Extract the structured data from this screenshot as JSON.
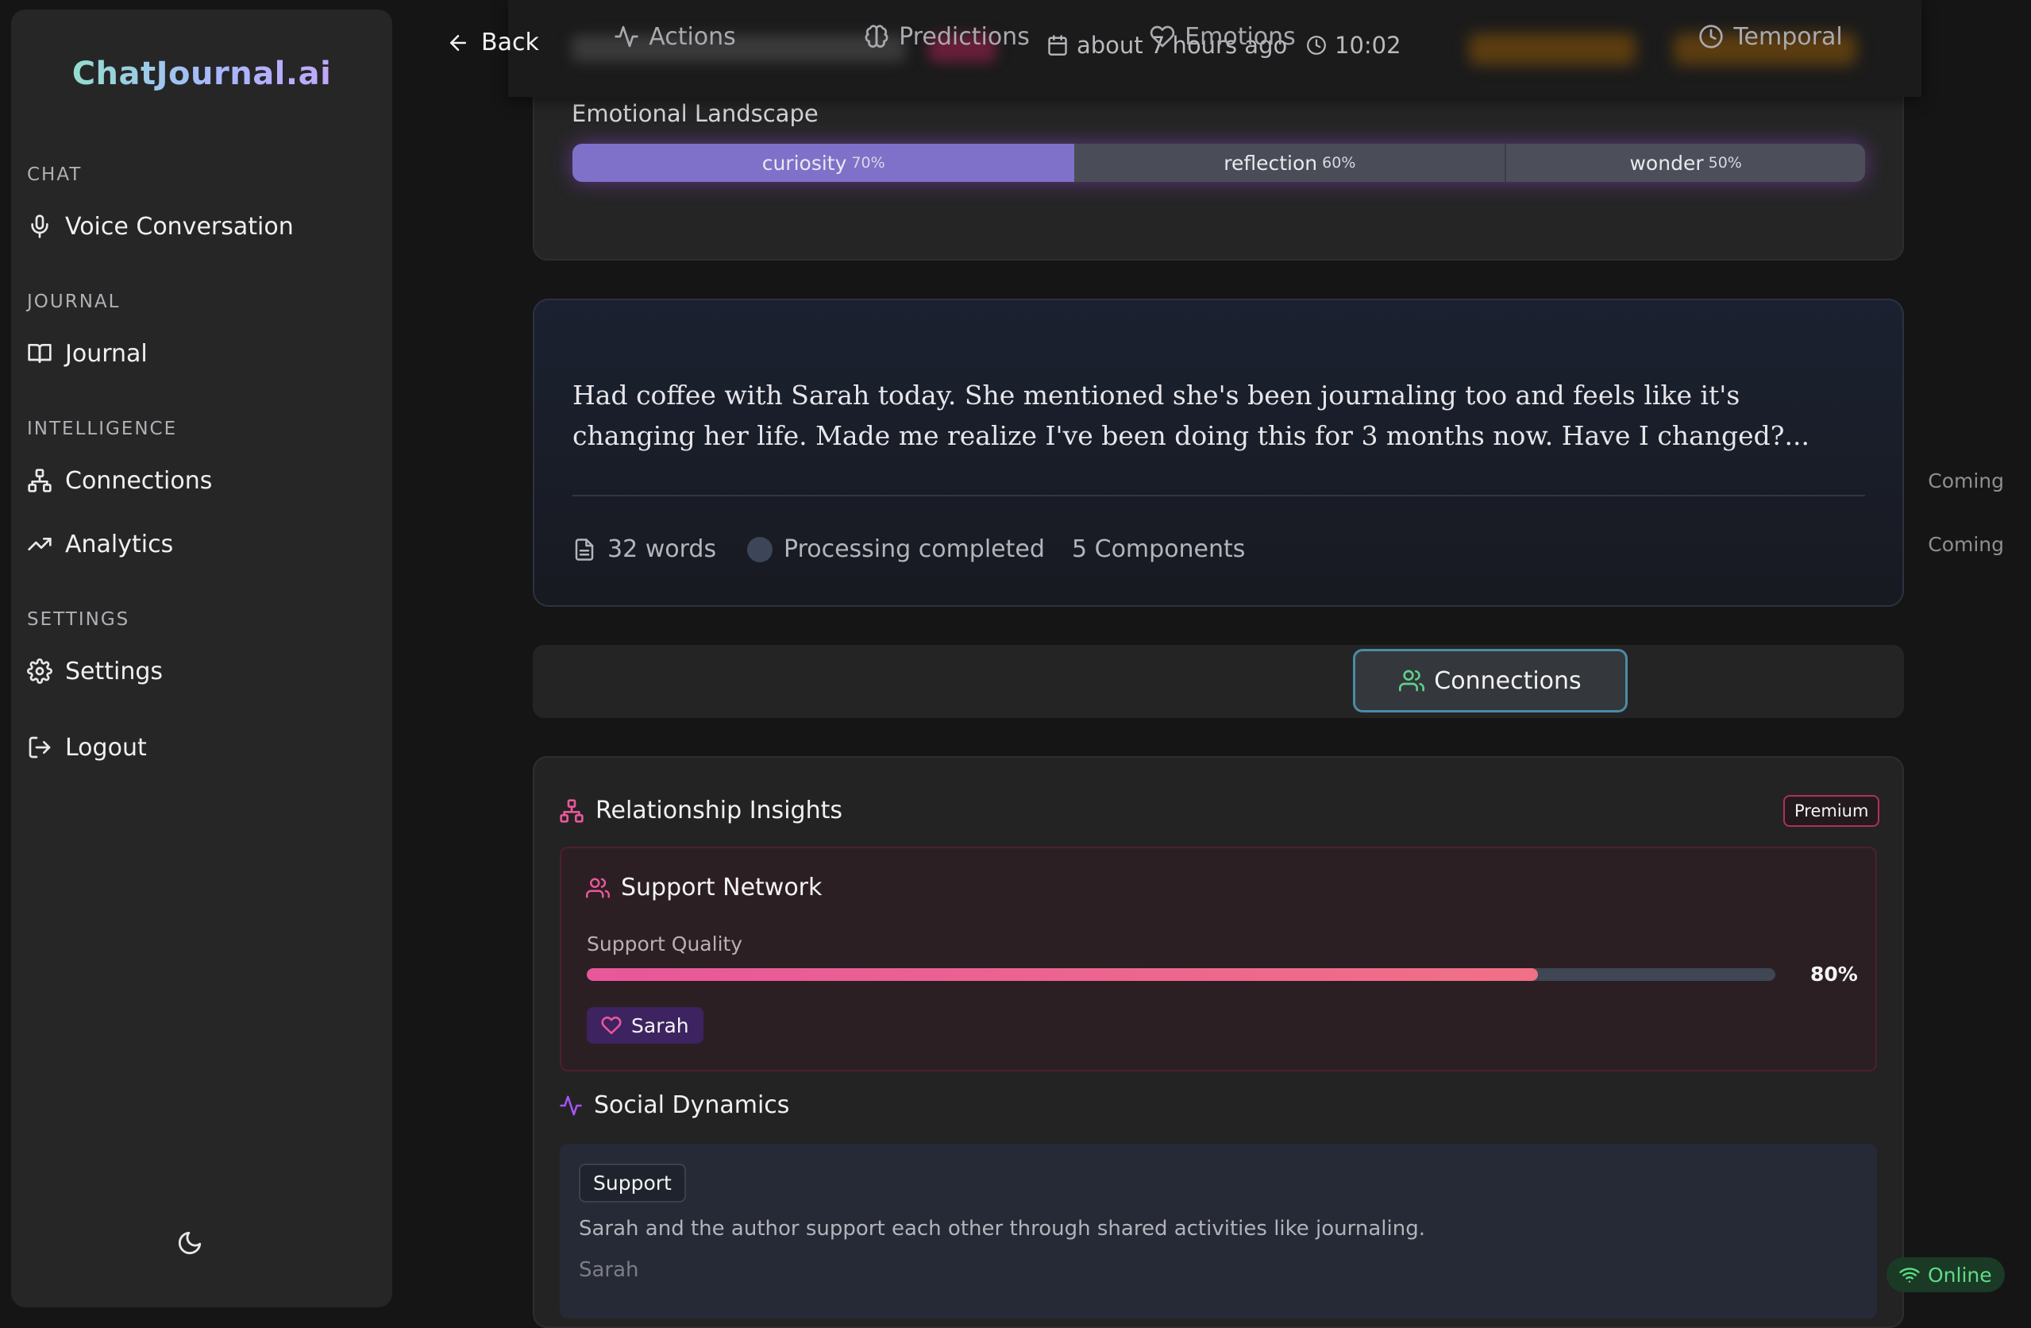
{
  "sidebar": {
    "brand": "ChatJournal.ai",
    "sections": [
      {
        "label": "CHAT",
        "items": [
          {
            "label": "Voice Conversation",
            "icon": "microphone-icon"
          }
        ]
      },
      {
        "label": "JOURNAL",
        "items": [
          {
            "label": "Journal",
            "icon": "book-open-icon"
          }
        ]
      },
      {
        "label": "INTELLIGENCE",
        "items": [
          {
            "label": "Connections",
            "icon": "network-icon",
            "badge": "Coming"
          },
          {
            "label": "Analytics",
            "icon": "trending-up-icon",
            "badge": "Coming"
          }
        ]
      },
      {
        "label": "SETTINGS",
        "items": [
          {
            "label": "Settings",
            "icon": "gear-icon"
          }
        ]
      }
    ],
    "logout": "Logout",
    "theme_icon": "moon-icon"
  },
  "header": {
    "back_label": "Back",
    "time_ago": "about 7 hours ago",
    "time": "10:02"
  },
  "emotional_landscape": {
    "title": "Emotional Landscape",
    "segments": [
      {
        "label": "curiosity",
        "pct_text": "70%",
        "value": 70
      },
      {
        "label": "reflection",
        "pct_text": "60%",
        "value": 60
      },
      {
        "label": "wonder",
        "pct_text": "50%",
        "value": 50
      }
    ]
  },
  "entry": {
    "text": "Had coffee with Sarah today. She mentioned she's been journaling too and feels like it's changing her life. Made me realize I've been doing this for 3 months now. Have I changed?...",
    "word_count": "32 words",
    "status": "Processing completed",
    "components": "5 Components"
  },
  "tabs": [
    {
      "label": "Actions",
      "icon": "activity-icon",
      "active": false
    },
    {
      "label": "Predictions",
      "icon": "brain-icon",
      "active": false
    },
    {
      "label": "Emotions",
      "icon": "heart-icon",
      "active": false
    },
    {
      "label": "Connections",
      "icon": "users-icon",
      "active": true
    },
    {
      "label": "Temporal",
      "icon": "clock-icon",
      "active": false
    }
  ],
  "insights": {
    "title": "Relationship Insights",
    "badge": "Premium",
    "support_network": {
      "title": "Support Network",
      "quality_label": "Support Quality",
      "quality_value": 0.8,
      "quality_text": "80%",
      "person": "Sarah"
    },
    "social_dynamics": {
      "title": "Social Dynamics",
      "tag": "Support",
      "description": "Sarah and the author support each other through shared activities like journaling.",
      "person": "Sarah"
    }
  },
  "status": {
    "online": "Online"
  },
  "colors": {
    "accent_purple": "#7f71c9",
    "active_tab_border": "#4c8ba6",
    "support_pink": "#e8579a",
    "online_green": "#5fdc86"
  }
}
